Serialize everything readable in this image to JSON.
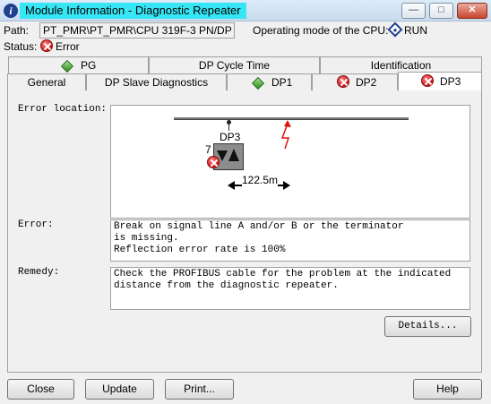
{
  "window": {
    "title": "Module Information - Diagnostic Repeater",
    "minimize_glyph": "—",
    "maximize_glyph": "□",
    "close_glyph": "✕"
  },
  "info": {
    "path_label": "Path:",
    "path_value": "PT_PMR\\PT_PMR\\CPU 319F-3 PN/DP",
    "mode_label": "Operating mode of the  CPU:",
    "mode_value": "RUN",
    "status_label": "Status:",
    "status_value": "Error"
  },
  "tabs_top": [
    "PG",
    "DP Cycle Time",
    "Identification"
  ],
  "tabs_bottom": [
    "General",
    "DP Slave Diagnostics",
    "DP1",
    "DP2",
    "DP3"
  ],
  "diagram": {
    "slave_name": "DP3",
    "slave_number": "7",
    "distance": "122.5m"
  },
  "fields": {
    "error_location_label": "Error location:",
    "error_label": "Error:",
    "error_lines": [
      "Break on signal line A and/or B or the terminator",
      "is missing.",
      "Reflection error rate is 100%"
    ],
    "remedy_label": "Remedy:",
    "remedy_lines": [
      "Check the PROFIBUS cable for the problem at the indicated",
      "distance from the diagnostic repeater."
    ]
  },
  "buttons": {
    "details": "Details...",
    "close": "Close",
    "update": "Update",
    "print": "Print...",
    "help": "Help"
  },
  "icons": {
    "app": "info-icon",
    "error": "error-icon",
    "run": "run-diamond-icon",
    "ok": "ok-diamond-icon"
  },
  "colors": {
    "title_highlight": "#37e6f5",
    "error_red": "#d01c1c",
    "ok_green": "#2b8a20",
    "fault_red": "#e01010"
  }
}
